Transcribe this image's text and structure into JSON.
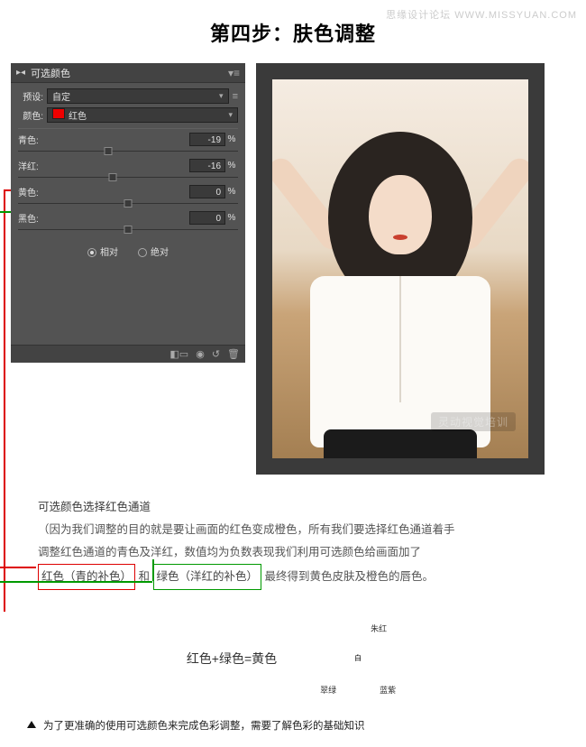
{
  "watermark": "思缘设计论坛  WWW.MISSYUAN.COM",
  "title": "第四步：肤色调整",
  "panel": {
    "tab": "可选颜色",
    "preset_label": "预设:",
    "preset_value": "自定",
    "color_label": "颜色:",
    "color_value": "红色",
    "sliders": [
      {
        "name": "青色:",
        "value": "-19",
        "pct": "%",
        "pos": 41
      },
      {
        "name": "洋红:",
        "value": "-16",
        "pct": "%",
        "pos": 43
      },
      {
        "name": "黄色:",
        "value": "0",
        "pct": "%",
        "pos": 50
      },
      {
        "name": "黑色:",
        "value": "0",
        "pct": "%",
        "pos": 50
      }
    ],
    "radio1": "相对",
    "radio2": "绝对"
  },
  "photo_watermark": "灵动视觉培训",
  "desc": {
    "l1": "可选颜色选择红色通道",
    "l2": "（因为我们调整的目的就是要让画面的红色变成橙色，所有我们要选择红色通道着手",
    "l3": "调整红色通道的青色及洋红，数值均为负数表现我们利用可选颜色给画面加了",
    "red_box": "红色（青的补色）",
    "and": "和",
    "green_box": "绿色（洋红的补色）",
    "tail": "最终得到黄色皮肤及橙色的唇色。"
  },
  "equation": "红色+绿色=黄色",
  "venn_labels": {
    "top": "朱红",
    "left": "翠绿",
    "right": "蓝紫",
    "center": "白"
  },
  "footer": "为了更准确的使用可选颜色来完成色彩调整，需要了解色彩的基础知识"
}
